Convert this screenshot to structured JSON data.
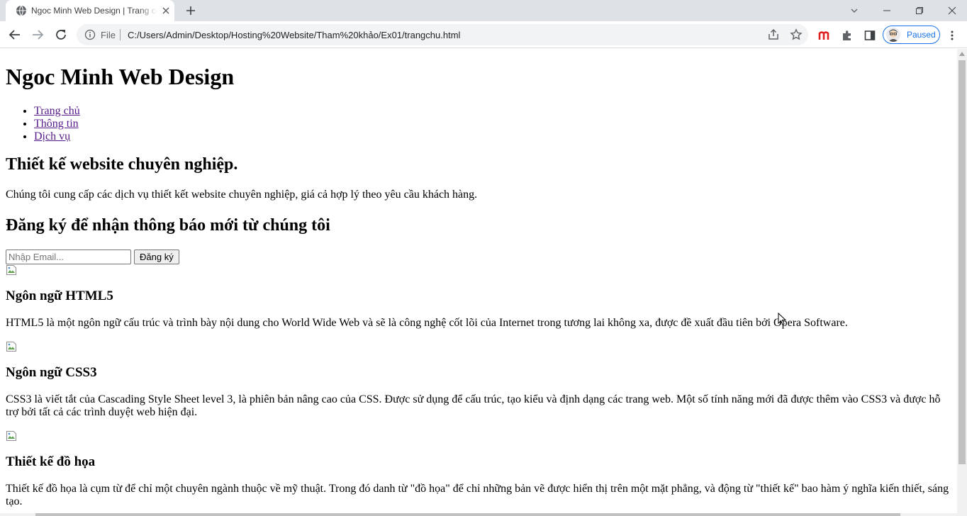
{
  "browser": {
    "tab_title": "Ngoc Minh Web Design | Trang chủ",
    "file_label": "File",
    "url": "C:/Users/Admin/Desktop/Hosting%20Website/Tham%20khảo/Ex01/trangchu.html",
    "profile_status": "Paused"
  },
  "page": {
    "site_title": "Ngoc Minh Web Design",
    "nav": [
      {
        "label": "Trang chủ"
      },
      {
        "label": "Thông tin"
      },
      {
        "label": "Dịch vụ"
      }
    ],
    "hero": {
      "heading": "Thiết kế website chuyên nghiệp.",
      "text": "Chúng tôi cung cấp các dịch vụ thiết kết website chuyên nghiệp, giá cả hợp lý theo yêu cầu khách hàng."
    },
    "newsletter": {
      "heading": "Đăng ký để nhận thông báo mới từ chúng tôi",
      "email_placeholder": "Nhập Email...",
      "submit_label": "Đăng ký"
    },
    "features": [
      {
        "heading": "Ngôn ngữ HTML5",
        "text": "HTML5 là một ngôn ngữ cấu trúc và trình bày nội dung cho World Wide Web và sẽ là công nghệ cốt lõi của Internet trong tương lai không xa, được đề xuất đầu tiên bởi Opera Software."
      },
      {
        "heading": "Ngôn ngữ CSS3",
        "text": "CSS3 là viết tắt của Cascading Style Sheet level 3, là phiên bản nâng cao của CSS. Được sử dụng để cấu trúc, tạo kiểu và định dạng các trang web. Một số tính năng mới đã được thêm vào CSS3 và được hỗ trợ bởi tất cả các trình duyệt web hiện đại."
      },
      {
        "heading": "Thiết kế đồ họa",
        "text": "Thiết kế đồ họa là cụm từ để chỉ một chuyên ngành thuộc về mỹ thuật. Trong đó danh từ \"đồ họa\" để chỉ những bản vẽ được hiển thị trên một mặt phẳng, và động từ \"thiết kế\" bao hàm ý nghĩa kiến thiết, sáng tạo."
      }
    ]
  }
}
